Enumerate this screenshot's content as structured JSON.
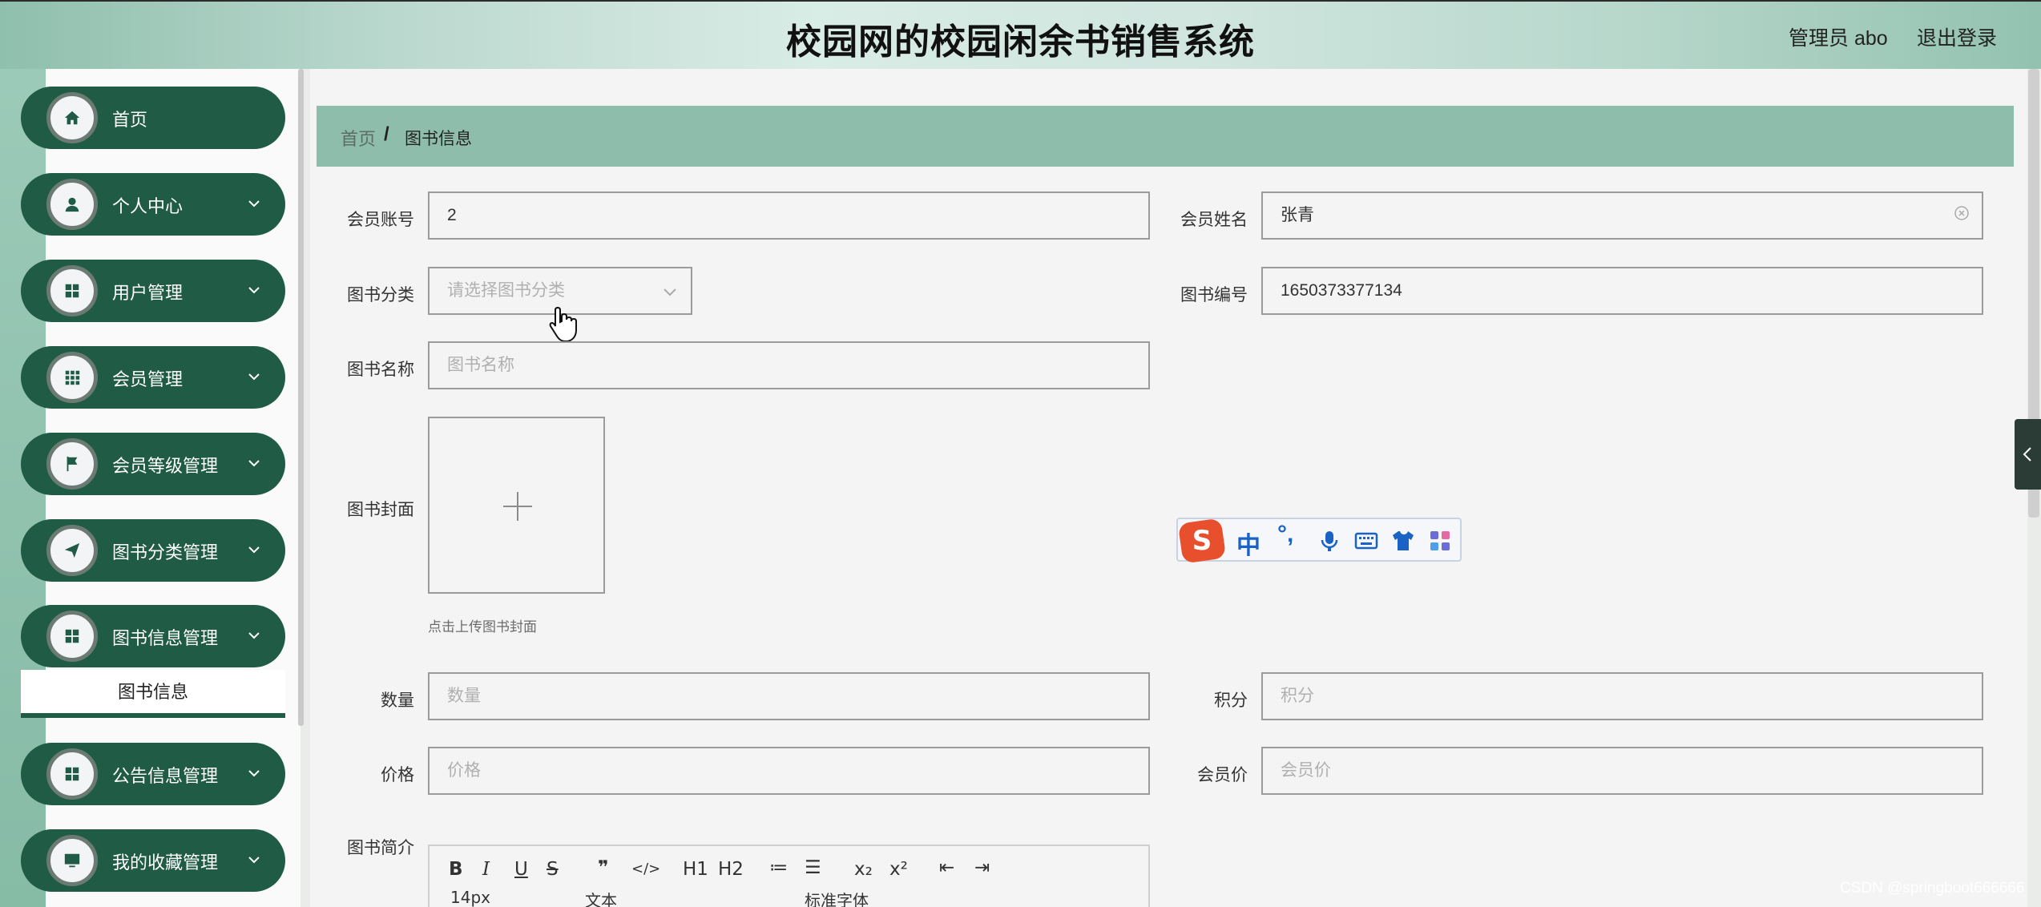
{
  "header": {
    "title": "校园网的校园闲余书销售系统",
    "admin": "管理员 abo",
    "logout": "退出登录"
  },
  "sidebar": {
    "items": [
      {
        "label": "首页",
        "icon": "home-icon"
      },
      {
        "label": "个人中心",
        "icon": "user-icon"
      },
      {
        "label": "用户管理",
        "icon": "grid-icon"
      },
      {
        "label": "会员管理",
        "icon": "apps-icon"
      },
      {
        "label": "会员等级管理",
        "icon": "flag-icon"
      },
      {
        "label": "图书分类管理",
        "icon": "send-icon"
      },
      {
        "label": "图书信息管理",
        "icon": "grid-icon"
      },
      {
        "label": "公告信息管理",
        "icon": "grid-icon"
      },
      {
        "label": "我的收藏管理",
        "icon": "monitor-icon"
      }
    ],
    "sub_item": "图书信息"
  },
  "breadcrumb": {
    "home": "首页",
    "separator": "/",
    "current": "图书信息"
  },
  "form": {
    "member_account": {
      "label": "会员账号",
      "value": "2"
    },
    "member_name": {
      "label": "会员姓名",
      "value": "张青"
    },
    "book_category": {
      "label": "图书分类",
      "placeholder": "请选择图书分类"
    },
    "book_number": {
      "label": "图书编号",
      "value": "1650373377134"
    },
    "book_name": {
      "label": "图书名称",
      "placeholder": "图书名称"
    },
    "book_cover": {
      "label": "图书封面",
      "tip": "点击上传图书封面"
    },
    "quantity": {
      "label": "数量",
      "placeholder": "数量"
    },
    "points": {
      "label": "积分",
      "placeholder": "积分"
    },
    "price": {
      "label": "价格",
      "placeholder": "价格"
    },
    "member_price": {
      "label": "会员价",
      "placeholder": "会员价"
    },
    "intro": {
      "label": "图书简介"
    }
  },
  "editor": {
    "row1": [
      "B",
      "I",
      "U",
      "S",
      "❞",
      "</>",
      "H1",
      "H2",
      "≔",
      "☰",
      "x₂",
      "x²",
      "⇤",
      "⇥"
    ],
    "font_size": "14px",
    "text_style": "文本",
    "font_family": "标准字体"
  },
  "ime": {
    "logo": "S",
    "lang": "中",
    "punct": "°,"
  },
  "watermark": "CSDN @springboot666666",
  "colors": {
    "sidebar_dark": "#1f5b45",
    "breadcrumb_bg": "#8fbdab",
    "header_gradient_mid": "#d9ece6"
  }
}
